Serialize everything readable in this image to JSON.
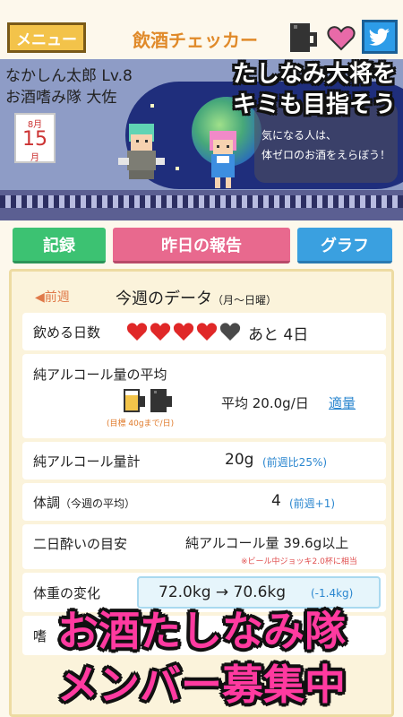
{
  "header": {
    "menu_label": "メニュー",
    "title": "飲酒チェッカー"
  },
  "banner": {
    "user_name": "なかしん太郎 Lv.8",
    "user_rank": "お酒嗜み隊 大佐",
    "calendar": {
      "month": "8月",
      "day": "15",
      "unit": "月"
    },
    "tip_line1": "気になる人は、",
    "tip_line2": "体ゼロのお酒をえらぼう！",
    "promo_line1": "たしなみ大将を",
    "promo_line2": "キミも目指そう"
  },
  "tabs": {
    "record": "記録",
    "report": "昨日の報告",
    "graph": "グラフ"
  },
  "week": {
    "prev_label": "◀前週",
    "title": "今週のデータ",
    "subtitle": "（月～日曜）"
  },
  "rows": {
    "drinkable_days": {
      "label": "飲める日数",
      "remaining": "あと 4日",
      "hearts_total": 5,
      "hearts_filled": 4
    },
    "alcohol_avg": {
      "label": "純アルコール量の平均",
      "value": "平均 20.0g/日",
      "link": "適量",
      "goal": "(目標 40gまで/日)"
    },
    "alcohol_total": {
      "label": "純アルコール量計",
      "value": "20g",
      "compare": "(前週比25%)"
    },
    "condition": {
      "label": "体調",
      "label_sub": "（今週の平均）",
      "value": "4",
      "compare": "(前週+1)"
    },
    "hangover": {
      "label": "二日酔いの目安",
      "value": "純アルコール量 39.6g以上",
      "note": "※ビール中ジョッキ2.0杯に相当"
    },
    "weight": {
      "label": "体重の変化",
      "value": "72.0kg → 70.6kg",
      "compare": "(-1.4kg)"
    },
    "partial": {
      "label": "嗜"
    }
  },
  "promo": {
    "line1": "お酒たしなみ隊",
    "line2": "メンバー募集中"
  },
  "colors": {
    "accent_orange": "#e08a2a",
    "heart_red": "#e02828",
    "tab_green": "#3cc272",
    "tab_pink": "#e8698e",
    "tab_blue": "#3aa0e0",
    "promo_pink": "#ff3aa0"
  },
  "icons": [
    "beer-mug-icon",
    "heart-icon",
    "twitter-icon",
    "calendar-icon"
  ]
}
